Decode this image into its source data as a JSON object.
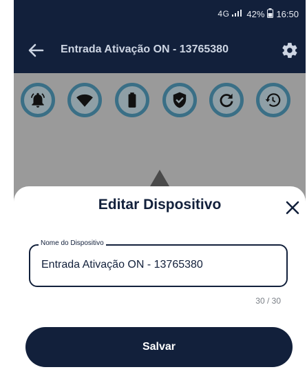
{
  "status_bar": {
    "network": "4G",
    "battery": "42%",
    "time": "16:50",
    "icons": [
      "signal-icon",
      "battery-icon"
    ]
  },
  "app_bar": {
    "title": "Entrada Ativação ON - 13765380",
    "back_icon": "arrow-left-icon",
    "settings_icon": "gear-icon"
  },
  "action_icons": [
    "alarm-bell-icon",
    "wifi-icon",
    "battery-icon",
    "shield-check-icon",
    "refresh-icon",
    "history-icon"
  ],
  "sheet": {
    "title": "Editar Dispositivo",
    "close_icon": "close-icon",
    "field": {
      "label": "Nome do Dispositivo",
      "value": "Entrada Ativação ON - 13765380",
      "counter": "30 / 30"
    },
    "save_label": "Salvar"
  },
  "colors": {
    "primary": "#12203b",
    "icon_ring": "#3a6f86",
    "overlay": "#9a9a9a"
  }
}
